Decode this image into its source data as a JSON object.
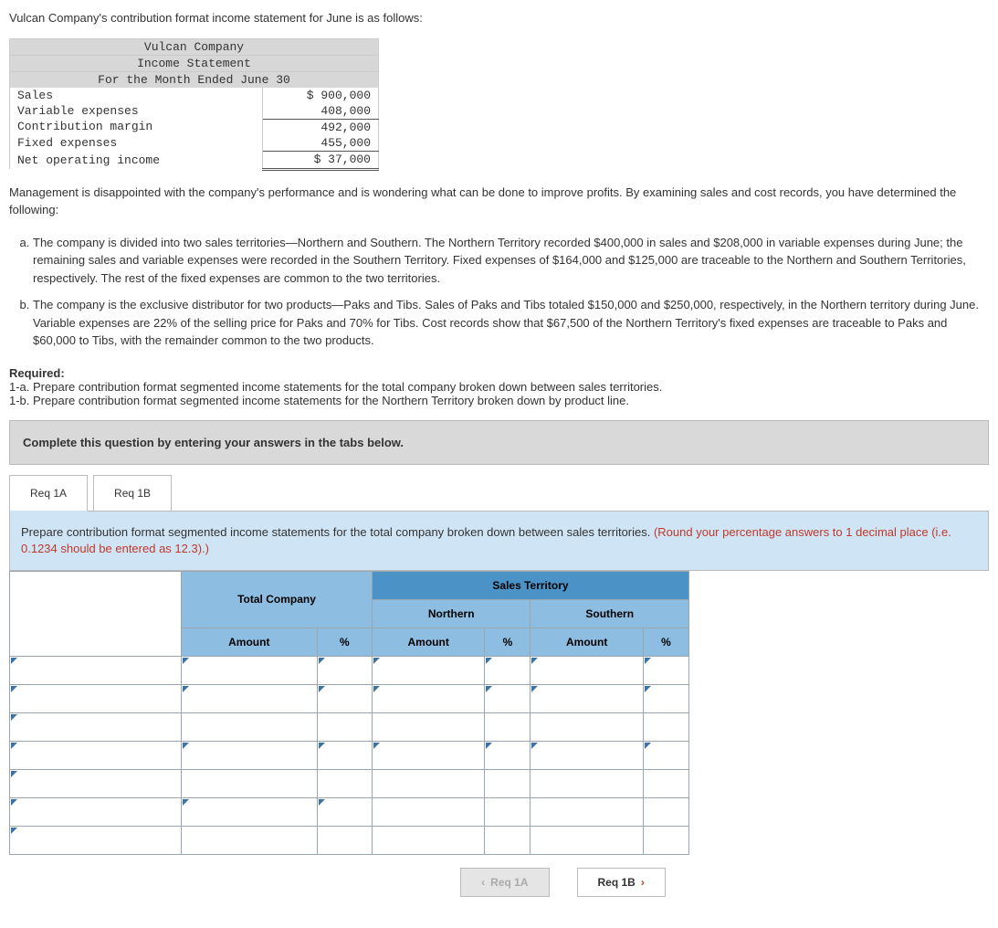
{
  "intro_text": "Vulcan Company's contribution format income statement for June is as follows:",
  "statement": {
    "header1": "Vulcan Company",
    "header2": "Income Statement",
    "header3": "For the Month Ended June 30",
    "rows": {
      "sales_label": "Sales",
      "sales_value": "$ 900,000",
      "var_label": "Variable expenses",
      "var_value": "408,000",
      "cm_label": "Contribution margin",
      "cm_value": "492,000",
      "fixed_label": "Fixed expenses",
      "fixed_value": "455,000",
      "noi_label": "Net operating income",
      "noi_value": "$  37,000"
    }
  },
  "para2": "Management is disappointed with the company's performance and is wondering what can be done to improve profits. By examining sales and cost records, you have determined the following:",
  "list": {
    "a": "The company is divided into two sales territories—Northern and Southern. The Northern Territory recorded $400,000 in sales and $208,000 in variable expenses during June; the remaining sales and variable expenses were recorded in the Southern Territory. Fixed expenses of $164,000 and $125,000 are traceable to the Northern and Southern Territories, respectively. The rest of the fixed expenses are common to the two territories.",
    "b": "The company is the exclusive distributor for two products—Paks and Tibs. Sales of Paks and Tibs totaled $150,000 and $250,000, respectively, in the Northern territory during June. Variable expenses are 22% of the selling price for Paks and 70% for Tibs. Cost records show that $67,500 of the Northern Territory's fixed expenses are traceable to Paks and $60,000 to Tibs, with the remainder common to the two products."
  },
  "required": {
    "header": "Required:",
    "r1a": "1-a. Prepare contribution format segmented income statements for the total company broken down between sales territories.",
    "r1b": "1-b. Prepare contribution format segmented income statements for the Northern Territory broken down by product line."
  },
  "instruction_bar": "Complete this question by entering your answers in the tabs below.",
  "tabs": {
    "tab1": "Req 1A",
    "tab2": "Req 1B"
  },
  "tab_panel": {
    "text_black": "Prepare contribution format segmented income statements for the total company broken down between sales territories. ",
    "text_red": "(Round your percentage answers to 1 decimal place (i.e. 0.1234 should be entered as 12.3).)"
  },
  "table": {
    "territory_header": "Sales Territory",
    "col_total": "Total Company",
    "col_north": "Northern",
    "col_south": "Southern",
    "sub_amount": "Amount",
    "sub_pct": "%"
  },
  "nav": {
    "prev": "Req 1A",
    "next": "Req 1B"
  }
}
